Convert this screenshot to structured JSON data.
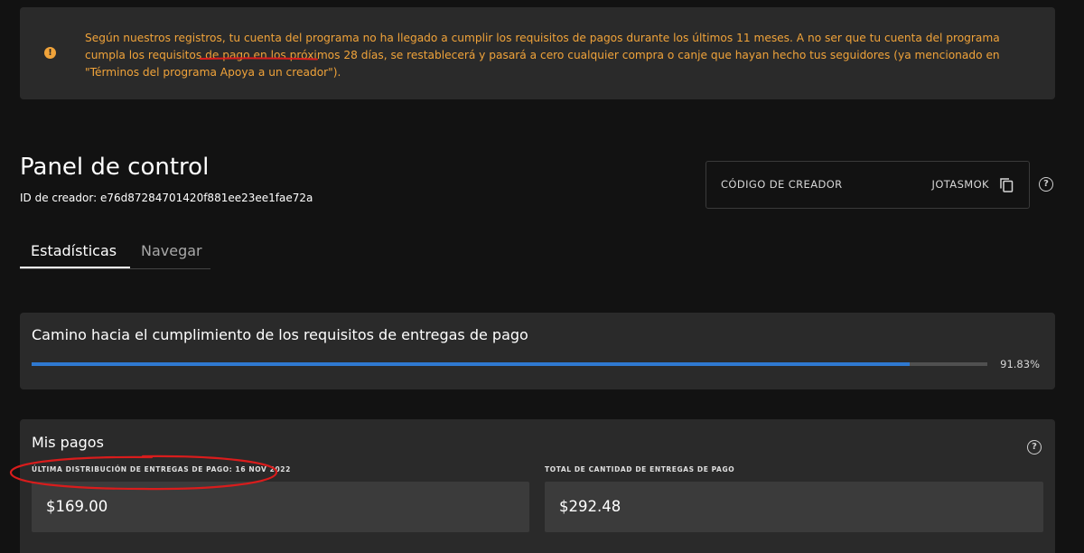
{
  "alert": {
    "text_before": "Según nuestros registros, tu cuenta del programa no ha llegado a cumplir los requisitos de pagos durante los últimos 11 meses. A no ser que tu cuenta del programa cumpla los requisitos de pago en los ",
    "text_highlight": "próximos 28 días",
    "text_after": ", se restablecerá y pasará a cero cualquier compra o canje que hayan hecho tus seguidores (ya mencionado en \"Términos del programa Apoya a un creador\").",
    "icon": "exclamation-icon",
    "color": "#f0a33a"
  },
  "header": {
    "title": "Panel de control",
    "creator_id": "ID de creador: e76d87284701420f881ee23ee1fae72a"
  },
  "creator_code": {
    "label": "CÓDIGO DE CREADOR",
    "value": "JOTASMOK",
    "icon": "copy-icon"
  },
  "tabs": [
    {
      "label": "Estadísticas",
      "active": true
    },
    {
      "label": "Navegar",
      "active": false
    }
  ],
  "progress": {
    "title": "Camino hacia el cumplimiento de los requisitos de entregas de pago",
    "value_label": "91.83%",
    "fraction": 0.9183,
    "color": "#2f79d0"
  },
  "pagos": {
    "title": "Mis pagos",
    "last_distribution": {
      "label": "ÚLTIMA DISTRIBUCIÓN DE ENTREGAS DE PAGO: 16 NOV 2022",
      "value": "$169.00"
    },
    "total": {
      "label": "TOTAL DE CANTIDAD DE ENTREGAS DE PAGO",
      "value": "$292.48"
    }
  },
  "annotation_color": "#d91c1c"
}
